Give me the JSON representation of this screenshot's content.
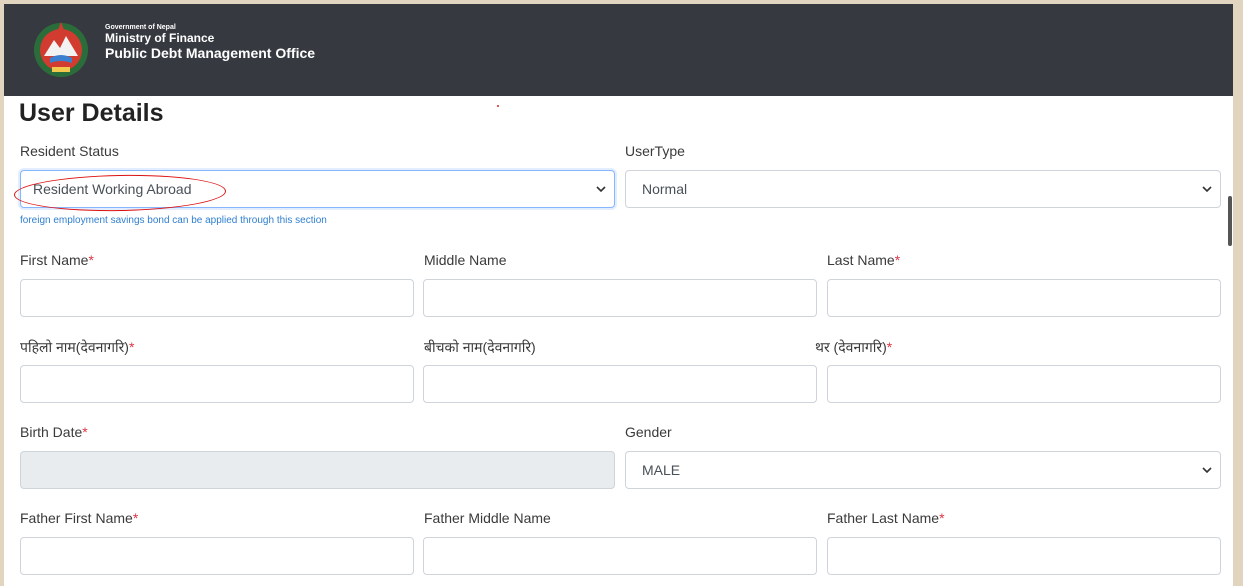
{
  "header": {
    "government": "Government of Nepal",
    "ministry": "Ministry of Finance",
    "office": "Public Debt Management Office"
  },
  "page_title": "User Details",
  "form": {
    "resident_status": {
      "label": "Resident Status",
      "value": "Resident Working Abroad",
      "hint": "foreign employment savings bond can be applied through this section"
    },
    "user_type": {
      "label": "UserType",
      "value": "Normal"
    },
    "first_name": {
      "label": "First Name",
      "required": "*"
    },
    "middle_name": {
      "label": "Middle Name"
    },
    "last_name": {
      "label": "Last Name",
      "required": "*"
    },
    "first_name_np": {
      "label": "पहिलो नाम(देवनागरि)",
      "required": "*"
    },
    "middle_name_np": {
      "label": "बीचको नाम(देवनागरि)"
    },
    "last_name_np": {
      "label": "थर (देवनागरि)",
      "required": "*"
    },
    "birth_date": {
      "label": "Birth Date",
      "required": "*"
    },
    "gender": {
      "label": "Gender",
      "value": "MALE"
    },
    "father_first_name": {
      "label": "Father First Name",
      "required": "*"
    },
    "father_middle_name": {
      "label": "Father Middle Name"
    },
    "father_last_name": {
      "label": "Father Last Name",
      "required": "*"
    }
  },
  "colors": {
    "header_bg": "#363a40",
    "required": "#dc3545",
    "hint": "#2f7fd0",
    "annotation": "#dd1111"
  },
  "icons": {
    "select_arrow": "chevron-down-icon",
    "emblem": "nepal-emblem-icon"
  }
}
